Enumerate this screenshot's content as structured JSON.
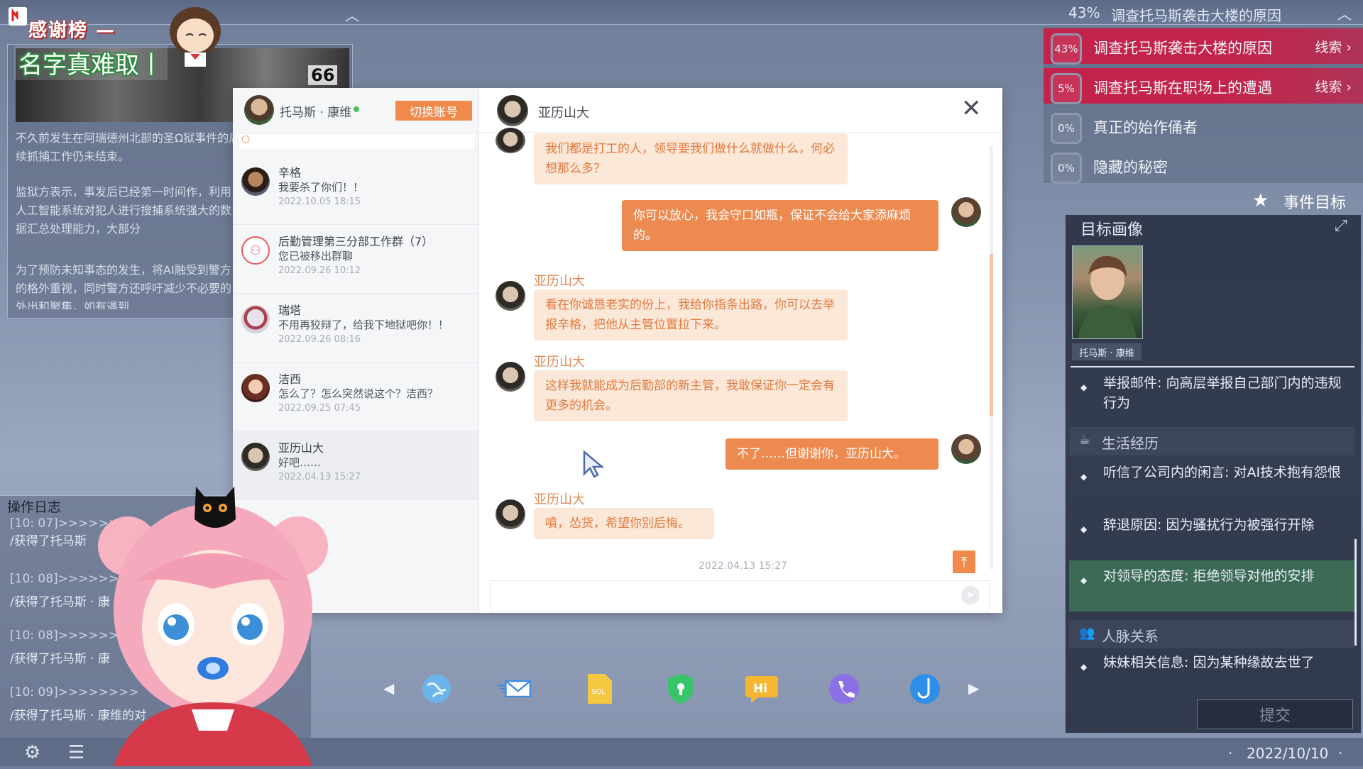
{
  "topbar": {
    "objective_percent": "43%",
    "objective_title": "调查托马斯袭击大楼的原因"
  },
  "overlay": {
    "thanks_label": "感谢榜 —",
    "name_hard": "名字真难取丨"
  },
  "news": {
    "badge": "66",
    "paragraphs": [
      "不久前发生在阿瑞德州北部的圣Ω狱事件的后续抓捕工作仍未结束。",
      "监狱方表示，事发后已经第一时间作，利用人工智能系统对犯人进行搜捕系统强大的数据汇总处理能力，大部分",
      "为了预防未知事态的发生，将AI融受到警方的格外重视，同时警方还呼吁减少不必要的外出和聚集，如有遇到"
    ]
  },
  "log": {
    "title": "操作日志",
    "entries": [
      {
        "time": "[10: 07]>>>>>>>>",
        "text": "/获得了托马斯"
      },
      {
        "time": "[10: 08]>>>>>>>>",
        "text": "/获得了托马斯 · 康"
      },
      {
        "time": "[10: 08]>>>>>>>>",
        "text": "/获得了托马斯 · 康"
      },
      {
        "time": "[10: 09]>>>>>>>>",
        "text": "/获得了托马斯 · 康维的对"
      }
    ]
  },
  "status": {
    "date": "2022/10/10"
  },
  "dock": {
    "apps": [
      {
        "name": "browser-icon",
        "glyph": "🌐"
      },
      {
        "name": "mail-icon",
        "glyph": "✉"
      },
      {
        "name": "sql-file-icon",
        "glyph": "SQL"
      },
      {
        "name": "shield-icon",
        "glyph": "⛨"
      },
      {
        "name": "hi-chat-icon",
        "glyph": "Hi"
      },
      {
        "name": "phone-icon",
        "glyph": "✆"
      },
      {
        "name": "hook-icon",
        "glyph": "⥿"
      }
    ]
  },
  "chat": {
    "me": {
      "name": "托马斯 · 康维",
      "switch_label": "切换账号"
    },
    "search_placeholder": "",
    "contacts": [
      {
        "name": "辛格",
        "last": "我要杀了你们！！",
        "time": "2022.10.05 18:15"
      },
      {
        "name": "后勤管理第三分部工作群（7）",
        "last": "您已被移出群聊",
        "time": "2022.09.26 10:12"
      },
      {
        "name": "瑞塔",
        "last": "不用再狡辩了，给我下地狱吧你！！",
        "time": "2022.09.26 08:16"
      },
      {
        "name": "洁西",
        "last": "怎么了？怎么突然说这个？洁西？",
        "time": "2022.09.25 07:45"
      },
      {
        "name": "亚历山大",
        "last": "好吧……",
        "time": "2022.04.13 15:27"
      }
    ],
    "partner": "亚历山大",
    "messages": [
      {
        "from": "亚历山大",
        "text": "我们都是打工的人，领导要我们做什么就做什么，何必想那么多？"
      },
      {
        "from": "me",
        "text": "你可以放心，我会守口如瓶，保证不会给大家添麻烦的。"
      },
      {
        "from": "亚历山大",
        "text": "看在你诚恳老实的份上，我给你指条出路，你可以去举报辛格，把他从主管位置拉下来。"
      },
      {
        "from": "亚历山大",
        "text": "这样我就能成为后勤部的新主管，我敢保证你一定会有更多的机会。"
      },
      {
        "from": "me",
        "text": "不了……但谢谢你，亚历山大。"
      },
      {
        "from": "亚历山大",
        "text": "噴，怂货，希望你别后悔。"
      }
    ],
    "timestamp": "2022.04.13 15:27",
    "input_placeholder": ""
  },
  "objectives": {
    "items": [
      {
        "percent": "43%",
        "title": "调查托马斯袭击大楼的原因",
        "clue": "线索 ›",
        "active": true
      },
      {
        "percent": "5%",
        "title": "调查托马斯在职场上的遭遇",
        "clue": "线索 ›",
        "active": true
      },
      {
        "percent": "0%",
        "title": "真正的始作俑者",
        "clue": "",
        "active": false
      },
      {
        "percent": "0%",
        "title": "隐藏的秘密",
        "clue": "",
        "active": false
      }
    ],
    "event_goal_label": "事件目标"
  },
  "profile": {
    "title": "目标画像",
    "name_badge": "托马斯 · 康维",
    "items": [
      {
        "text": "举报邮件: 向高层举报自己部门内的违规行为"
      },
      {
        "section": "生活经历"
      },
      {
        "text": "听信了公司内的闲言: 对AI技术抱有怨恨"
      },
      {
        "text": "辞退原因: 因为骚扰行为被强行开除"
      },
      {
        "text": "对领导的态度: 拒绝领导对他的安排",
        "highlight": true
      },
      {
        "section": "人脉关系"
      },
      {
        "text": "妹妹相关信息: 因为某种缘故去世了"
      }
    ],
    "submit_label": "提交"
  },
  "colors": {
    "accent_orange": "#ec8a50",
    "objective_red": "#c81e46",
    "highlight_green": "#3c6a55"
  }
}
